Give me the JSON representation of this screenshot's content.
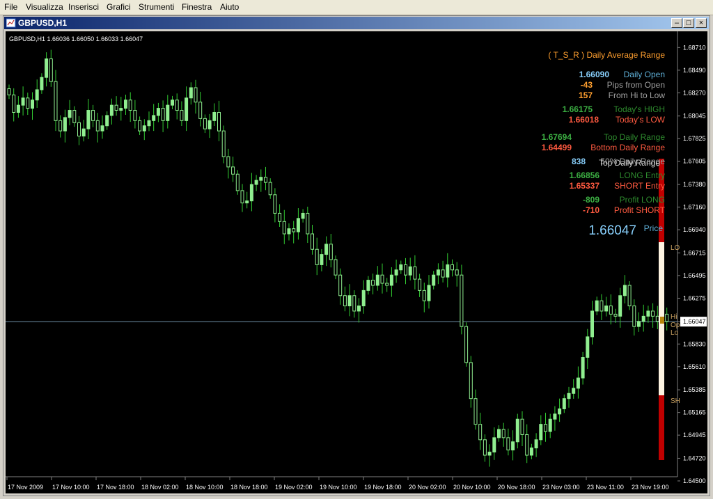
{
  "menu": [
    "File",
    "Visualizza",
    "Inserisci",
    "Grafici",
    "Strumenti",
    "Finestra",
    "Aiuto"
  ],
  "window": {
    "title": "GBPUSD,H1",
    "min_icon": "minimize-icon",
    "max_icon": "maximize-icon",
    "close_icon": "close-icon"
  },
  "colors": {
    "background": "#000000",
    "bull": "#90ee90",
    "bear": "#000000",
    "wick": "#32cd32",
    "text_orange": "#ff9f2f",
    "text_blue": "#87cefa",
    "text_grey": "#a0a0a0",
    "text_green": "#3cb043",
    "text_red": "#ff5a40",
    "bar_red": "#c00000",
    "bar_cream": "#fdf3e1"
  },
  "chart_data": {
    "type": "candlestick",
    "symbol": "GBPUSD,H1",
    "ohlc_text": "GBPUSD,H1  1.66036 1.66050 1.66033 1.66047",
    "y_ticks": [
      "1.68710",
      "1.68490",
      "1.68270",
      "1.68045",
      "1.67825",
      "1.67605",
      "1.67380",
      "1.67160",
      "1.66940",
      "1.66715",
      "1.66495",
      "1.66275",
      "1.66047",
      "1.65830",
      "1.65610",
      "1.65385",
      "1.65165",
      "1.64945",
      "1.64720",
      "1.64500"
    ],
    "y_values": [
      1.6871,
      1.6849,
      1.6827,
      1.68045,
      1.67825,
      1.67605,
      1.6738,
      1.6716,
      1.6694,
      1.66715,
      1.66495,
      1.66275,
      1.66047,
      1.6583,
      1.6561,
      1.65385,
      1.65165,
      1.64945,
      1.6472,
      1.645
    ],
    "x_ticks": [
      "17 Nov 2009",
      "17 Nov 10:00",
      "17 Nov 18:00",
      "18 Nov 02:00",
      "18 Nov 10:00",
      "18 Nov 18:00",
      "19 Nov 02:00",
      "19 Nov 10:00",
      "19 Nov 18:00",
      "20 Nov 02:00",
      "20 Nov 10:00",
      "20 Nov 18:00",
      "23 Nov 03:00",
      "23 Nov 11:00",
      "23 Nov 19:00"
    ],
    "ylim": [
      1.645,
      1.688
    ],
    "current_price": 1.66047,
    "current_price_label": "1.66047",
    "closes": [
      1.6825,
      1.6808,
      1.6815,
      1.6822,
      1.6812,
      1.682,
      1.683,
      1.6842,
      1.686,
      1.6838,
      1.68,
      1.679,
      1.6803,
      1.681,
      1.6798,
      1.6785,
      1.6792,
      1.681,
      1.68,
      1.679,
      1.6795,
      1.6805,
      1.6815,
      1.681,
      1.6812,
      1.682,
      1.681,
      1.68,
      1.679,
      1.6795,
      1.68,
      1.6805,
      1.6812,
      1.68,
      1.6815,
      1.682,
      1.681,
      1.68,
      1.6822,
      1.6832,
      1.6818,
      1.6802,
      1.6792,
      1.68,
      1.6808,
      1.679,
      1.6765,
      1.6755,
      1.6748,
      1.6732,
      1.672,
      1.6722,
      1.6738,
      1.6742,
      1.6745,
      1.674,
      1.6728,
      1.671,
      1.6702,
      1.669,
      1.6695,
      1.6692,
      1.6705,
      1.671,
      1.669,
      1.6675,
      1.666,
      1.667,
      1.668,
      1.6665,
      1.665,
      1.663,
      1.662,
      1.663,
      1.6615,
      1.662,
      1.6635,
      1.6645,
      1.664,
      1.665,
      1.6642,
      1.664,
      1.665,
      1.6655,
      1.666,
      1.665,
      1.6658,
      1.6646,
      1.6635,
      1.6625,
      1.664,
      1.665,
      1.6655,
      1.6648,
      1.666,
      1.6655,
      1.665,
      1.66,
      1.6565,
      1.653,
      1.6505,
      1.649,
      1.6475,
      1.6478,
      1.6492,
      1.65,
      1.6492,
      1.648,
      1.6488,
      1.651,
      1.6495,
      1.6475,
      1.6482,
      1.649,
      1.6505,
      1.6498,
      1.651,
      1.6515,
      1.652,
      1.653,
      1.6535,
      1.654,
      1.655,
      1.657,
      1.659,
      1.6615,
      1.6625,
      1.6615,
      1.662,
      1.6612,
      1.661,
      1.663,
      1.664,
      1.662,
      1.66,
      1.6605,
      1.661,
      1.6615,
      1.661,
      1.6605,
      1.6612,
      1.6605
    ]
  },
  "tsr": {
    "title": "( T_S_R ) Daily Average Range",
    "rows": [
      {
        "value": "1.66090",
        "label": "Daily Open",
        "vcolor": "#87cefa",
        "lcolor": "#5fb0d8"
      },
      {
        "value": "-43",
        "label": "Pips from Open",
        "vcolor": "#ff9f2f",
        "lcolor": "#a0a0a0"
      },
      {
        "value": "157",
        "label": "From Hi to Low",
        "vcolor": "#ff9f2f",
        "lcolor": "#a0a0a0"
      },
      {
        "value": "1.66175",
        "label": "Today's HIGH",
        "vcolor": "#3cb043",
        "lcolor": "#2e8b2e"
      },
      {
        "value": "1.66018",
        "label": "Today's LOW",
        "vcolor": "#ff5a40",
        "lcolor": "#ff5a40"
      },
      {
        "value": "1.67694",
        "label": "Top Daily Range",
        "vcolor": "#3cb043",
        "lcolor": "#2e8b2e"
      },
      {
        "value": "1.64499",
        "label": "Bottom Daily Range",
        "vcolor": "#ff5a40",
        "lcolor": "#ff5a40"
      },
      {
        "value": "838",
        "label": "50% Daily Range",
        "vcolor": "#87cefa",
        "lcolor": "#a0a0a0"
      },
      {
        "value": "1.66856",
        "label": "LONG Entry",
        "vcolor": "#3cb043",
        "lcolor": "#2e8b2e"
      },
      {
        "value": "1.65337",
        "label": "SHORT Entry",
        "vcolor": "#ff5a40",
        "lcolor": "#ff5a40"
      },
      {
        "value": "-809",
        "label": "Profit LONG",
        "vcolor": "#3cb043",
        "lcolor": "#2e8b2e"
      },
      {
        "value": "-710",
        "label": "Profit SHORT",
        "vcolor": "#ff5a40",
        "lcolor": "#ff5a40"
      }
    ],
    "price_value": "1.66047",
    "price_label": "Price",
    "overlap_label": "Top Daily Range",
    "side_labels": {
      "long": "LO",
      "hi": "Hi",
      "op": "Op",
      "lo": "Lo",
      "short": "SH"
    }
  }
}
